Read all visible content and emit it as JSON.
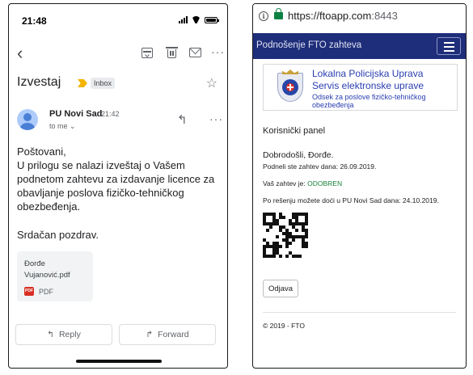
{
  "email": {
    "status_time": "21:48",
    "subject": "Izvestaj",
    "label": "Inbox",
    "sender": "PU Novi Sad",
    "time": "21:42",
    "to": "to me ⌄",
    "body_lines": "Poštovani,\nU prilogu se nalazi izveštaj o Vašem podnetom zahtevu za izdavanje licence za obavljanje poslova fizičko-tehničkog obezbeđenja.",
    "closing": "Srdačan pozdrav.",
    "attachment": {
      "name": "Đorđe Vujanović.pdf",
      "type": "PDF",
      "icon_text": "PDF"
    },
    "reply_label": "Reply",
    "forward_label": "Forward",
    "colors": {
      "importance": "#f4b400",
      "avatar": "#4a7fd6"
    }
  },
  "browser": {
    "url_host": "https://ftoapp.com",
    "url_port": ":8443",
    "nav_title": "Podnošenje FTO zahteva",
    "banner": {
      "title_line1": "Lokalna Policijska Uprava",
      "title_line2": "Servis elektronske uprave",
      "subtitle": "Odsek za poslove fizičko-tehničkog obezbeđenja"
    },
    "panel_title": "Korisnički panel",
    "welcome": "Dobrodošli, Đorđe.",
    "submitted": "Podneli ste zahtev dana: 26.09.2019.",
    "status_prefix": "Vaš zahtev je:",
    "status_value": "ODOBREN",
    "pickup": "Po rešenju možete doći u PU Novi Sad dana: 24.10.2019.",
    "logout_label": "Odjava",
    "footer": "© 2019 - FTO",
    "colors": {
      "navbar": "#1f2e7a",
      "banner_text": "#2a3eb1",
      "approved": "#188038",
      "lock": "#0b8043"
    }
  }
}
